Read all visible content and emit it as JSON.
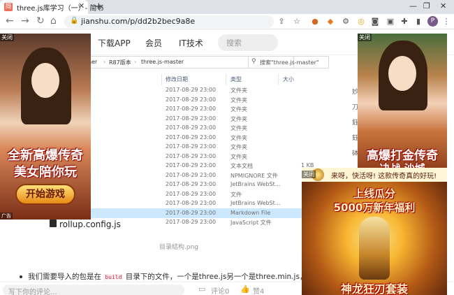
{
  "browser": {
    "tab_title": "three.js库学习（一）- 简书",
    "tab_favicon": "简",
    "url": "jianshu.com/p/dd2b2bec9a8e",
    "profile_letter": "P"
  },
  "site_nav": {
    "items": [
      "下载APP",
      "会员",
      "IT技术"
    ],
    "search_placeholder": "搜索"
  },
  "explorer": {
    "breadcrumb": [
      "ner",
      "R87版本",
      "three.js-master"
    ],
    "search_text": "搜索\"three.js-master\"",
    "columns": [
      "修改日期",
      "类型",
      "大小"
    ],
    "rows": [
      {
        "date": "2017-08-29 23:00",
        "type": "文件夹",
        "size": ""
      },
      {
        "date": "2017-08-29 23:00",
        "type": "文件夹",
        "size": ""
      },
      {
        "date": "2017-08-29 23:00",
        "type": "文件夹",
        "size": ""
      },
      {
        "date": "2017-08-29 23:00",
        "type": "文件夹",
        "size": ""
      },
      {
        "date": "2017-08-29 23:00",
        "type": "文件夹",
        "size": ""
      },
      {
        "date": "2017-08-29 23:00",
        "type": "文件夹",
        "size": ""
      },
      {
        "date": "2017-08-29 23:00",
        "type": "文件夹",
        "size": ""
      },
      {
        "date": "2017-08-29 23:00",
        "type": "文件夹",
        "size": ""
      },
      {
        "date": "2017-08-29 23:00",
        "type": "文本文档",
        "size": "1 KB"
      },
      {
        "date": "2017-08-29 23:00",
        "type": "NPMIGNORE 文件",
        "size": ""
      },
      {
        "date": "2017-08-29 23:00",
        "type": "JetBrains WebSt...",
        "size": ""
      },
      {
        "date": "2017-08-29 23:00",
        "type": "文件",
        "size": ""
      },
      {
        "date": "2017-08-29 23:00",
        "type": "JetBrains WebSt...",
        "size": ""
      },
      {
        "date": "2017-08-29 23:00",
        "type": "Markdown File",
        "size": ""
      },
      {
        "date": "2017-08-29 23:00",
        "type": "JavaScript 文件",
        "size": ""
      }
    ],
    "last_file_name": "rollup.config.js"
  },
  "caption": "目录结构.png",
  "paragraph": {
    "before": "我们需要导入的包是在",
    "code": "build",
    "after": "目录下的文件，一个是three.js另一个是three.min.js，这"
  },
  "comment_bar": {
    "placeholder": "写下你的评论...",
    "comment_label": "评论0",
    "like_label": "赞4"
  },
  "sidebar_sliver": [
    "妙",
    "刀",
    "鈺",
    "鈺",
    "砵"
  ],
  "ads": {
    "close_label": "关闭",
    "ad_label": "广告",
    "left_line1": "全新高爆传奇",
    "left_line2": "美女陪你玩",
    "left_button": "开始游戏",
    "right_line1": "高爆打金传奇",
    "right_line2": "决战 沙城",
    "bottom_top": "来呀，快活呀! 这款传奇真的好玩!",
    "bottom_line1": "上线瓜分",
    "bottom_line2": "5000万新年福利",
    "bottom_line3": "神龙狂刃套装"
  },
  "colors": {
    "tab_bg": "#dee1e6",
    "selected_row": "#cce8ff",
    "code_color": "#c7254e"
  }
}
